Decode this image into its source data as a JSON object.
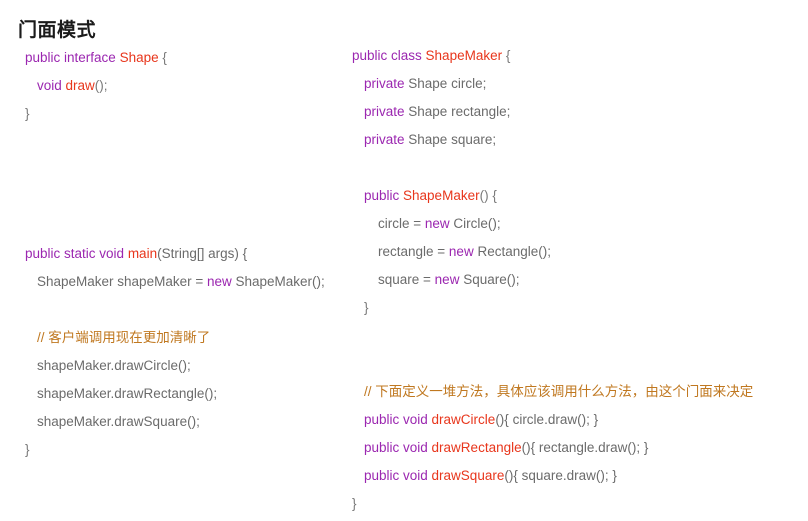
{
  "document": {
    "title": "门面模式",
    "background": "#ffffff",
    "colors": {
      "title": "#1a1a1a",
      "keyword": "#9b27b0",
      "type": "#e8361c",
      "method": "#e8361c",
      "plain": "#6b6b6b",
      "comment": "#c07820",
      "punctuation": "#7a7a7a"
    }
  },
  "columns": {
    "left": {
      "name": "shape-interface-and-main",
      "lines": [
        {
          "indent": 0,
          "tokens": [
            {
              "t": "public interface ",
              "c": "kw"
            },
            {
              "t": "Shape",
              "c": "type"
            },
            {
              "t": " {",
              "c": "punct"
            }
          ]
        },
        {
          "indent": 1,
          "tokens": [
            {
              "t": "void ",
              "c": "kw"
            },
            {
              "t": "draw",
              "c": "fn"
            },
            {
              "t": "();",
              "c": "punct"
            }
          ]
        },
        {
          "indent": 0,
          "tokens": [
            {
              "t": "}",
              "c": "punct"
            }
          ]
        },
        {
          "indent": 0,
          "tokens": [
            {
              "t": " ",
              "c": "plain"
            }
          ]
        },
        {
          "indent": 0,
          "tokens": [
            {
              "t": " ",
              "c": "plain"
            }
          ]
        },
        {
          "indent": 0,
          "tokens": [
            {
              "t": " ",
              "c": "plain"
            }
          ]
        },
        {
          "indent": 0,
          "tokens": [
            {
              "t": " ",
              "c": "plain"
            }
          ]
        },
        {
          "indent": 0,
          "tokens": [
            {
              "t": "public static void ",
              "c": "kw"
            },
            {
              "t": "main",
              "c": "fn"
            },
            {
              "t": "(String[] args) {",
              "c": "plain"
            }
          ]
        },
        {
          "indent": 1,
          "tokens": [
            {
              "t": "ShapeMaker shapeMaker = ",
              "c": "plain"
            },
            {
              "t": "new",
              "c": "kw"
            },
            {
              "t": " ShapeMaker();",
              "c": "plain"
            }
          ]
        },
        {
          "indent": 0,
          "tokens": [
            {
              "t": " ",
              "c": "plain"
            }
          ]
        },
        {
          "indent": 1,
          "tokens": [
            {
              "t": "// 客户端调用现在更加清晰了",
              "c": "comment"
            }
          ]
        },
        {
          "indent": 1,
          "tokens": [
            {
              "t": "shapeMaker.drawCircle();",
              "c": "plain"
            }
          ]
        },
        {
          "indent": 1,
          "tokens": [
            {
              "t": "shapeMaker.drawRectangle();",
              "c": "plain"
            }
          ]
        },
        {
          "indent": 1,
          "tokens": [
            {
              "t": "shapeMaker.drawSquare();",
              "c": "plain"
            }
          ]
        },
        {
          "indent": 0,
          "tokens": [
            {
              "t": "}",
              "c": "punct"
            }
          ]
        }
      ]
    },
    "right": {
      "name": "shapemaker-facade-class",
      "lines": [
        {
          "indent": 0,
          "tokens": [
            {
              "t": "public class ",
              "c": "kw"
            },
            {
              "t": "ShapeMaker",
              "c": "type"
            },
            {
              "t": " {",
              "c": "punct"
            }
          ]
        },
        {
          "indent": 1,
          "tokens": [
            {
              "t": "private",
              "c": "kw"
            },
            {
              "t": " Shape circle;",
              "c": "plain"
            }
          ]
        },
        {
          "indent": 1,
          "tokens": [
            {
              "t": "private",
              "c": "kw"
            },
            {
              "t": " Shape rectangle;",
              "c": "plain"
            }
          ]
        },
        {
          "indent": 1,
          "tokens": [
            {
              "t": "private",
              "c": "kw"
            },
            {
              "t": " Shape square;",
              "c": "plain"
            }
          ]
        },
        {
          "indent": 0,
          "tokens": [
            {
              "t": " ",
              "c": "plain"
            }
          ]
        },
        {
          "indent": 1,
          "tokens": [
            {
              "t": "public ",
              "c": "kw"
            },
            {
              "t": "ShapeMaker",
              "c": "type"
            },
            {
              "t": "() {",
              "c": "punct"
            }
          ]
        },
        {
          "indent": 2,
          "tokens": [
            {
              "t": "circle = ",
              "c": "plain"
            },
            {
              "t": "new",
              "c": "kw"
            },
            {
              "t": " Circle();",
              "c": "plain"
            }
          ]
        },
        {
          "indent": 2,
          "tokens": [
            {
              "t": "rectangle = ",
              "c": "plain"
            },
            {
              "t": "new",
              "c": "kw"
            },
            {
              "t": " Rectangle();",
              "c": "plain"
            }
          ]
        },
        {
          "indent": 2,
          "tokens": [
            {
              "t": "square = ",
              "c": "plain"
            },
            {
              "t": "new",
              "c": "kw"
            },
            {
              "t": " Square();",
              "c": "plain"
            }
          ]
        },
        {
          "indent": 1,
          "tokens": [
            {
              "t": "}",
              "c": "punct"
            }
          ]
        },
        {
          "indent": 0,
          "tokens": [
            {
              "t": " ",
              "c": "plain"
            }
          ]
        },
        {
          "indent": 0,
          "tokens": [
            {
              "t": " ",
              "c": "plain"
            }
          ]
        },
        {
          "indent": 1,
          "tokens": [
            {
              "t": "// 下面定义一堆方法，具体应该调用什么方法，由这个门面来决定",
              "c": "comment"
            }
          ]
        },
        {
          "indent": 1,
          "tokens": [
            {
              "t": "public void ",
              "c": "kw"
            },
            {
              "t": "drawCircle",
              "c": "fn"
            },
            {
              "t": "(){ circle.draw(); }",
              "c": "plain"
            }
          ]
        },
        {
          "indent": 1,
          "tokens": [
            {
              "t": "public void ",
              "c": "kw"
            },
            {
              "t": "drawRectangle",
              "c": "fn"
            },
            {
              "t": "(){ rectangle.draw(); }",
              "c": "plain"
            }
          ]
        },
        {
          "indent": 1,
          "tokens": [
            {
              "t": "public void ",
              "c": "kw"
            },
            {
              "t": "drawSquare",
              "c": "fn"
            },
            {
              "t": "(){ square.draw(); }",
              "c": "plain"
            }
          ]
        },
        {
          "indent": 0,
          "tokens": [
            {
              "t": "}",
              "c": "punct"
            }
          ]
        }
      ]
    }
  }
}
